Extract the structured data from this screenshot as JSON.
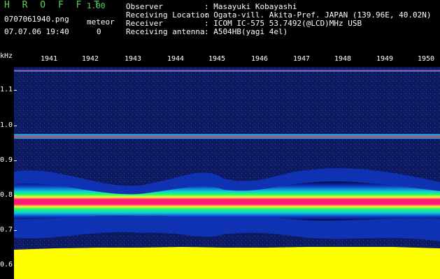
{
  "header": {
    "app_name": "H R O F F T",
    "version": "1.00",
    "filename": "0707061940.png",
    "meteor_label": "meteor",
    "datetime": "07.07.06 19:40",
    "meteor_count": "0"
  },
  "station": {
    "rows": [
      {
        "label": "Observer",
        "value": ": Masayuki Kobayashi"
      },
      {
        "label": "Receiving Location",
        "value": ": Ogata-vill. Akita-Pref. JAPAN (139.96E, 40.02N)"
      },
      {
        "label": "Receiver",
        "value": ": ICOM IC-575 53.7492(@LCD)MHz USB"
      },
      {
        "label": "Receiving antenna",
        "value": ": A504HB(yagi 4el)"
      }
    ]
  },
  "axes": {
    "y_unit": "kHz",
    "y_ticks": [
      "1.1",
      "1.0",
      "0.9",
      "0.8",
      "0.7",
      "0.6"
    ],
    "x_ticks": [
      "1941",
      "1942",
      "1943",
      "1944",
      "1945",
      "1946",
      "1947",
      "1948",
      "1949",
      "1950"
    ]
  },
  "colors": {
    "background": "#000000",
    "brand": "#5ad25a",
    "noise": "#101a5c",
    "signal_low": "#1a4fe0",
    "signal_mid": "#10d8c8",
    "signal_high": "#ff1a7a",
    "ground": "#ffff00",
    "line": "#ff3355"
  }
}
